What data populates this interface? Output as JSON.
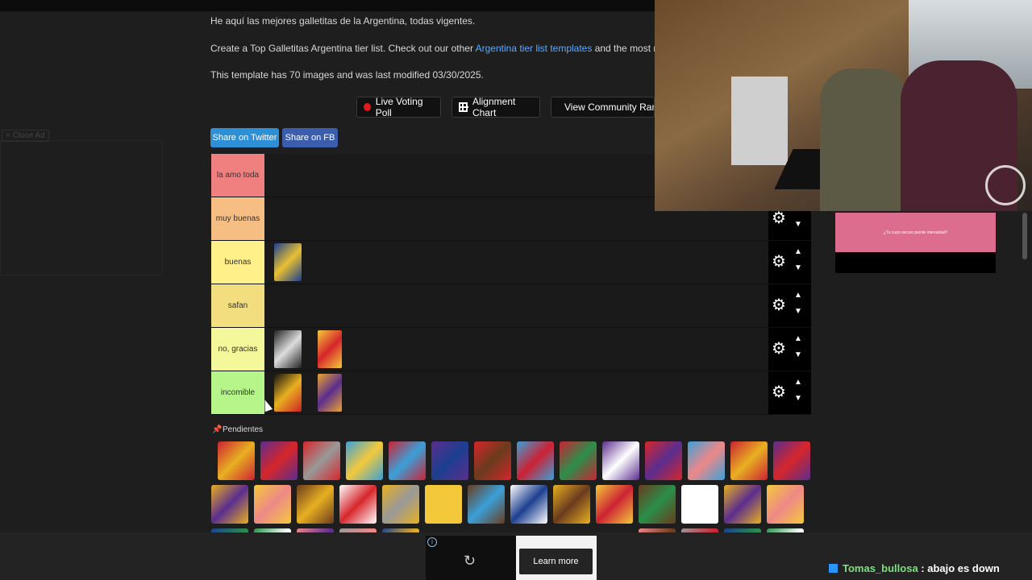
{
  "description": {
    "line1": "He aquí las mejores galletitas de la Argentina, todas vigentes.",
    "line2_pre": "Create a Top Galletitas Argentina tier list. Check out our other ",
    "line2_link": "Argentina tier list templates",
    "line2_post": " and the most recent",
    "line3": "This template has 70 images and was last modified 03/30/2025."
  },
  "close_ad": "× Close Ad",
  "toolbar": {
    "live_voting": "Live Voting Poll",
    "alignment_chart": "Alignment Chart",
    "community_rank": "View Community Ran"
  },
  "share": {
    "twitter": "Share on Twitter",
    "fb": "Share on FB",
    "twitter_color": "#2d8fd5",
    "fb_color": "#3b5dae"
  },
  "tiers": [
    {
      "label": "la amo toda",
      "color": "#f08080"
    },
    {
      "label": "muy buenas",
      "color": "#f7be83"
    },
    {
      "label": "buenas",
      "color": "#fff08a"
    },
    {
      "label": "safan",
      "color": "#f2dd7f"
    },
    {
      "label": "no, gracias",
      "color": "#f4f79a"
    },
    {
      "label": "incomible",
      "color": "#b6f58a"
    }
  ],
  "pool_label": "Pendientes",
  "side_banner": "¿Tu cupo oscuro pierde intensidad?",
  "ad": {
    "learn_more": "Learn more"
  },
  "chat": {
    "user": "Tomas_bullosa",
    "message": " : abajo es down"
  }
}
